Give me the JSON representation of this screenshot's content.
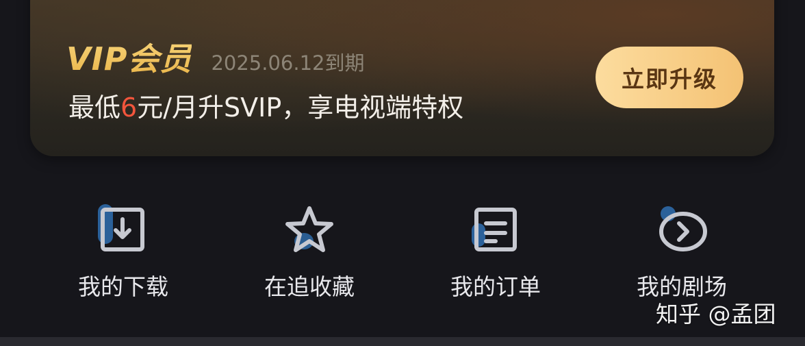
{
  "vip": {
    "title": "VIP会员",
    "expiry": "2025.06.12到期",
    "promo_prefix": "最低",
    "promo_highlight": "6",
    "promo_suffix": "元/月升SVIP，享电视端特权",
    "upgrade_label": "立即升级"
  },
  "quick_actions": [
    {
      "label": "我的下载",
      "icon": "download-icon"
    },
    {
      "label": "在追收藏",
      "icon": "star-icon"
    },
    {
      "label": "我的订单",
      "icon": "order-icon"
    },
    {
      "label": "我的剧场",
      "icon": "theater-icon"
    }
  ],
  "watermark": "知乎 @孟团",
  "colors": {
    "vip_gold": "#f2c35a",
    "highlight_red": "#f2553c",
    "button_gold": "#f4c274",
    "icon_stroke": "#c7c9d1",
    "icon_accent": "#2f6fb0",
    "background": "#16161b"
  }
}
